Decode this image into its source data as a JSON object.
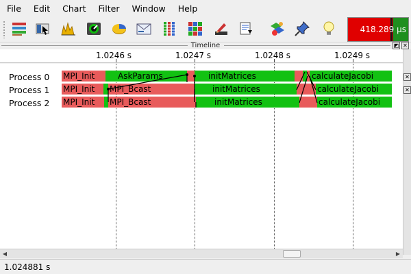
{
  "menu": [
    "File",
    "Edit",
    "Chart",
    "Filter",
    "Window",
    "Help"
  ],
  "toolbar": {
    "icons": [
      "list-icon",
      "pointer-icon",
      "bar-chart-icon",
      "gauge-icon",
      "pie-chart-icon",
      "envelope-icon",
      "grid-icon",
      "matrix-icon",
      "edit-icon",
      "save-icon",
      "color-icon",
      "pin-icon",
      "bulb-icon"
    ],
    "speed_value": "418.289 µs"
  },
  "dock": {
    "title": "Timeline",
    "float_button": "◩",
    "close_button": "✕"
  },
  "ruler": {
    "ticks": [
      "1.0246 s",
      "1.0247 s",
      "1.0248 s",
      "1.0249 s"
    ]
  },
  "processes": [
    {
      "name": "Process 0",
      "segments": [
        {
          "label": "MPI_Init",
          "state": "red"
        },
        {
          "label": "AskParams",
          "state": "green"
        },
        {
          "label": "",
          "state": "red"
        },
        {
          "label": "initMatrices",
          "state": "green"
        },
        {
          "label": "",
          "state": "red"
        },
        {
          "label": "",
          "state": "green"
        },
        {
          "label": "",
          "state": "red"
        },
        {
          "label": "calculateJacobi",
          "state": "green"
        }
      ]
    },
    {
      "name": "Process 1",
      "segments": [
        {
          "label": "MPI_Init",
          "state": "red"
        },
        {
          "label": "",
          "state": "green"
        },
        {
          "label": "MPI_Bcast",
          "state": "red"
        },
        {
          "label": "initMatrices",
          "state": "green"
        },
        {
          "label": "",
          "state": "red"
        },
        {
          "label": "calculateJacobi",
          "state": "green"
        }
      ]
    },
    {
      "name": "Process 2",
      "segments": [
        {
          "label": "MPI_Init",
          "state": "red"
        },
        {
          "label": "",
          "state": "green"
        },
        {
          "label": "MPI_Bcast",
          "state": "red"
        },
        {
          "label": "initMatrices",
          "state": "green"
        },
        {
          "label": "",
          "state": "red"
        },
        {
          "label": "calculateJacobi",
          "state": "green"
        }
      ]
    }
  ],
  "colors": {
    "running": "#12c112",
    "waiting": "#e85b5b",
    "message": "#000000"
  },
  "status": {
    "time": "1.024881 s"
  }
}
